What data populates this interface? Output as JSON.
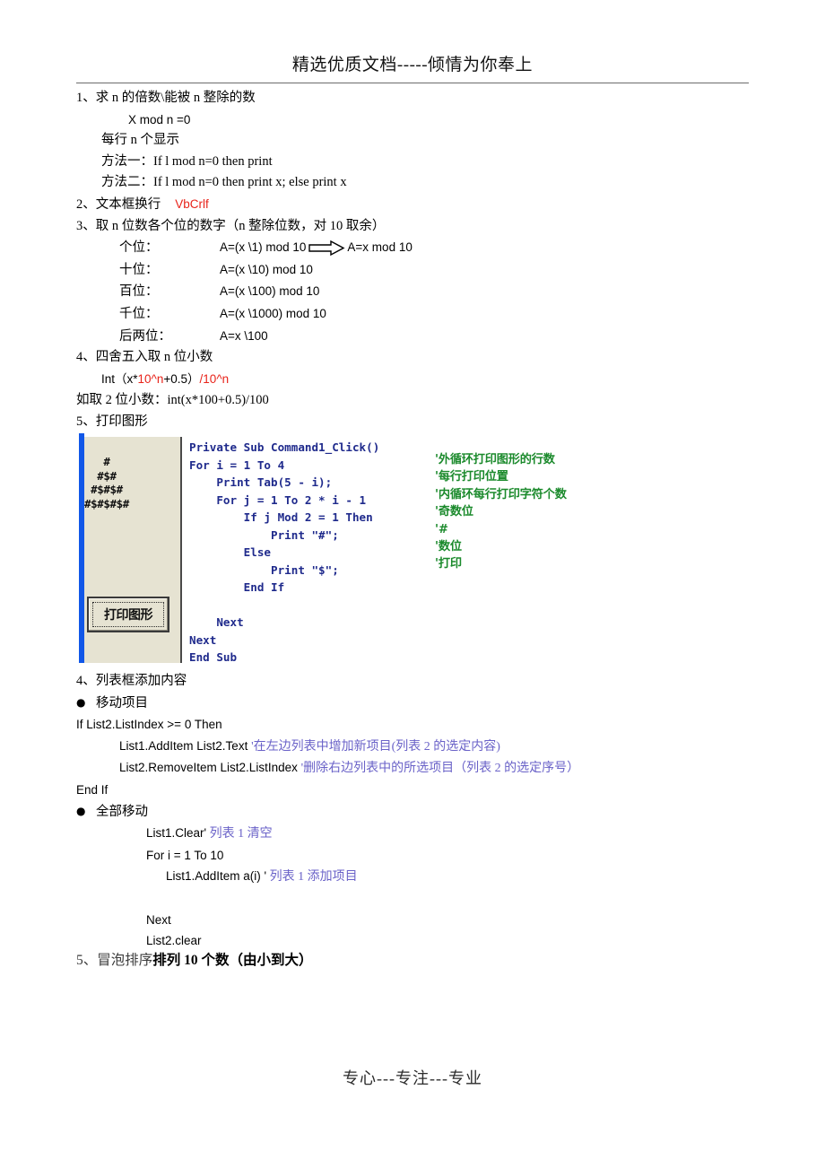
{
  "header": {
    "title": "精选优质文档-----倾情为你奉上"
  },
  "sections": {
    "s1": {
      "heading": "1、求 n 的倍数\\能被 n 整除的数",
      "formula": "X    mod    n =0",
      "note": "每行 n 个显示",
      "method1": "方法一：If     l mod n=0 then print",
      "method2": "方法二：If l mod n=0 then print x;   else   print x"
    },
    "s2": {
      "heading_han": "2、文本框换行",
      "value": "VbCrlf"
    },
    "s3": {
      "heading": "3、取 n 位数各个位的数字（n 整除位数，对 10 取余）",
      "rows": [
        {
          "label": "个位：",
          "expr": "A=(x \\1) mod 10",
          "arrow": true,
          "expr2": "A=x mod 10"
        },
        {
          "label": "十位：",
          "expr": "A=(x \\10) mod 10",
          "arrow": false,
          "expr2": ""
        },
        {
          "label": "百位：",
          "expr": "A=(x \\100) mod 10",
          "arrow": false,
          "expr2": ""
        },
        {
          "label": "千位：",
          "expr": "A=(x \\1000) mod 10",
          "arrow": false,
          "expr2": ""
        },
        {
          "label": "后两位：",
          "expr": "A=x \\100",
          "arrow": false,
          "expr2": ""
        }
      ]
    },
    "s4": {
      "heading": "4、四舍五入取 n 位小数",
      "formula_pre": "Int（x*",
      "formula_red1": "10^n",
      "formula_mid": "+0.5）",
      "formula_slash": "/",
      "formula_red2": "10^n",
      "example": "如取 2 位小数：int(x*100+0.5)/100"
    },
    "s5": {
      "heading": "5、打印图形"
    },
    "s6": {
      "heading": "4、列表框添加内容",
      "bullet1": "移动项目",
      "code1": "If List2.ListIndex >= 0 Then",
      "code2": "List1.AddItem List2.Text ",
      "comment2": "'在左边列表中增加新项目(列表 2 的选定内容)",
      "code3": "List2.RemoveItem List2.ListIndex      ",
      "comment3": "'删除右边列表中的所选项目（列表 2 的选定序号）",
      "code4": "End If",
      "bullet2": "全部移动",
      "code5": "List1.Clear'",
      "comment5": " 列表 1 清空",
      "code6": "For i = 1 To 10",
      "code7": "List1.AddItem a(i) '",
      "comment7": " 列表 1 添加项目",
      "code8": "Next",
      "code9": "List2.clear"
    },
    "s7": {
      "heading_light": "5、冒泡排序",
      "heading_bold": "排列 10 个数（由小到大）"
    }
  },
  "vb_screenshot": {
    "form": {
      "pyramid": "   #\n  #$#\n #$#$#\n#$#$#$#",
      "button_label": "打印图形"
    },
    "code": "Private Sub Command1_Click()\nFor i = 1 To 4\n    Print Tab(5 - i);\n    For j = 1 To 2 * i - 1\n        If j Mod 2 = 1 Then\n            Print \"#\";\n        Else\n            Print \"$\";\n        End If\n\n    Next\nNext\nEnd Sub",
    "comments": "'外循环打印图形的行数\n'每行打印位置\n'内循环每行打印字符个数\n'奇数位\n'#\n'数位\n'打印"
  },
  "footer": {
    "text": "专心---专注---专业"
  },
  "colors": {
    "red": "#e8231a",
    "violet": "#6a62c8",
    "code_blue": "#1f2a8c",
    "comment_green": "#1b8a2c",
    "form_bg": "#e6e3d2",
    "form_edge_blue": "#1157e8"
  }
}
